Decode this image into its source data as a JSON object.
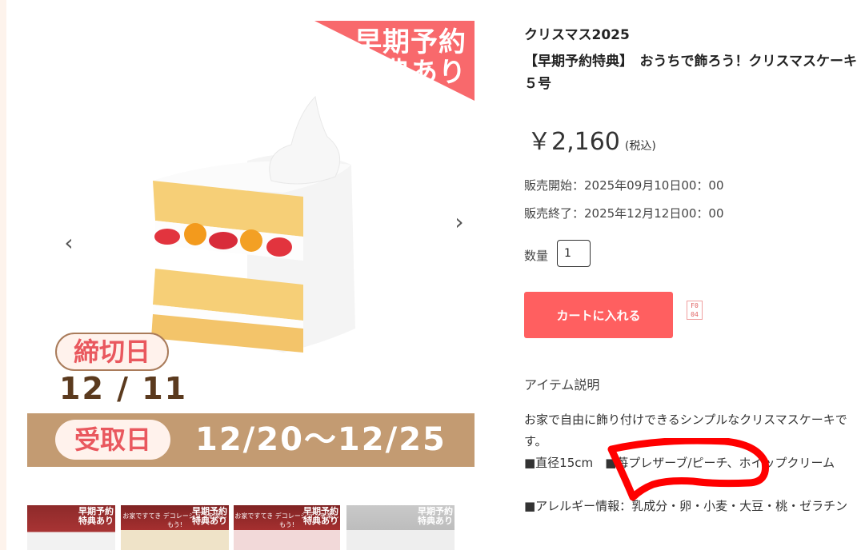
{
  "gallery": {
    "badge_line1": "早期予約",
    "badge_line2": "特典あり",
    "deadline_label": "締切日",
    "deadline_date": "12 / 11",
    "pickup_label": "受取日",
    "pickup_range": "12/20〜12/25",
    "prev_arrow": "‹",
    "next_arrow": "›",
    "thumbnails": [
      {
        "tag": "早期予約\n特典あり",
        "caption": ""
      },
      {
        "tag": "早期予約\n特典あり",
        "caption": "お家ですてき デコレーションを楽しもう!"
      },
      {
        "tag": "早期予約\n特典あり",
        "caption": "お家ですてき デコレーションを楽しもう!"
      },
      {
        "tag": "早期予約\n特典あり",
        "caption": ""
      }
    ]
  },
  "product": {
    "category": "クリスマス2025",
    "title": "【早期予約特典】　おうちで飾ろう！クリスマスケーキ５号",
    "price": "￥2,160",
    "tax_note": "(税込)",
    "sale_start": "販売開始：2025年09月10日00：00",
    "sale_end": "販売終了：2025年12月12日00：00",
    "quantity_label": "数量",
    "quantity_value": "1",
    "cart_button": "カートに入れる",
    "mini_icon_text": "F0\n04"
  },
  "description": {
    "heading": "アイテム説明",
    "line1": "お家で自由に飾り付けできるシンプルなクリスマスケーキです。",
    "line2": "■直径15cm　■苺プレザーブ/ピーチ、ホイップクリーム",
    "line3": "■アレルギー情報：乳成分・卵・小麦・大豆・桃・ゼラチン"
  },
  "colors": {
    "accent": "#ff5f60",
    "pickup_bar": "#c39b72",
    "deadline_text": "#e9585e",
    "annotation_red": "#ff0000"
  }
}
